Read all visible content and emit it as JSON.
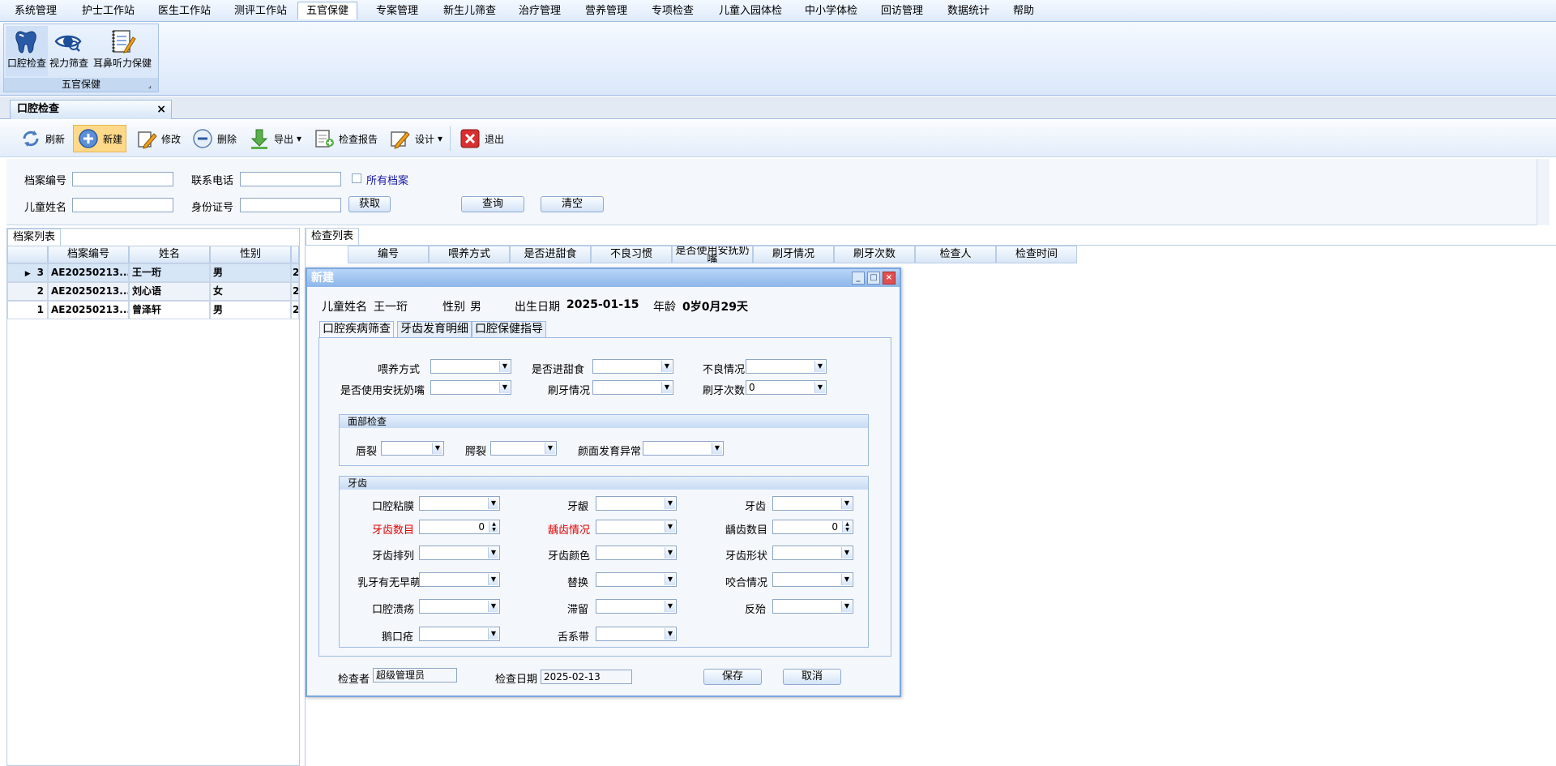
{
  "menu": {
    "items": [
      "系统管理",
      "护士工作站",
      "医生工作站",
      "测评工作站",
      "五官保健",
      "专案管理",
      "新生儿筛查",
      "治疗管理",
      "营养管理",
      "专项检查",
      "儿童入园体检",
      "中小学体检",
      "回访管理",
      "数据统计",
      "帮助"
    ],
    "active_index": 4
  },
  "ribbon": {
    "buttons": [
      {
        "label": "口腔检查",
        "icon": "tooth-icon"
      },
      {
        "label": "视力筛查",
        "icon": "eye-icon"
      },
      {
        "label": "耳鼻听力保健",
        "icon": "notepad-icon"
      }
    ],
    "group_title": "五官保健"
  },
  "doc_tab": {
    "label": "口腔检查",
    "close": "×"
  },
  "toolbar": {
    "refresh": "刷新",
    "new": "新建",
    "edit": "修改",
    "delete": "删除",
    "export": "导出",
    "report": "检查报告",
    "design": "设计",
    "exit": "退出",
    "dropdown": "▾"
  },
  "search": {
    "archive_no_label": "档案编号",
    "phone_label": "联系电话",
    "all_archives_label": "所有档案",
    "child_name_label": "儿童姓名",
    "id_card_label": "身份证号",
    "fetch_btn": "获取",
    "query_btn": "查询",
    "clear_btn": "清空"
  },
  "archive_list": {
    "tab": "档案列表",
    "headers": [
      "档案编号",
      "姓名",
      "性别"
    ],
    "rows": [
      {
        "num": "3",
        "archive": "AE20250213...",
        "name": "王一珩",
        "gender": "男",
        "extra": "2"
      },
      {
        "num": "2",
        "archive": "AE20250213...",
        "name": "刘心语",
        "gender": "女",
        "extra": "2"
      },
      {
        "num": "1",
        "archive": "AE20250213...",
        "name": "曾泽轩",
        "gender": "男",
        "extra": "2"
      }
    ],
    "row_pointer": "▶"
  },
  "check_list": {
    "tab": "检查列表",
    "headers": [
      "编号",
      "喂养方式",
      "是否进甜食",
      "不良习惯",
      "是否使用安抚奶嘴",
      "刷牙情况",
      "刷牙次数",
      "检查人",
      "检查时间"
    ]
  },
  "dialog": {
    "title": "新建",
    "controls": {
      "min": "_",
      "max": "□",
      "close": "×"
    },
    "child_name_label": "儿童姓名",
    "child_name": "王一珩",
    "gender_label": "性别",
    "gender": "男",
    "birth_label": "出生日期",
    "birth": "2025-01-15",
    "age_label": "年龄",
    "age": "0岁0月29天",
    "tabs": [
      "口腔疾病筛查",
      "牙齿发育明细",
      "口腔保健指导"
    ],
    "fields": {
      "feeding": "喂养方式",
      "sweets": "是否进甜食",
      "bad_habit": "不良情况",
      "pacifier": "是否使用安抚奶嘴",
      "brushing": "刷牙情况",
      "brush_times": "刷牙次数",
      "brush_times_value": "0"
    },
    "face_section": {
      "title": "面部检查",
      "lip": "唇裂",
      "palate": "腭裂",
      "face": "颜面发育异常"
    },
    "teeth_section": {
      "title": "牙齿",
      "mucosa": "口腔粘膜",
      "gum": "牙龈",
      "teeth": "牙齿",
      "teeth_count": "牙齿数目",
      "teeth_count_value": "0",
      "caries": "龋齿情况",
      "caries_count": "龋齿数目",
      "caries_count_value": "0",
      "alignment": "牙齿排列",
      "color": "牙齿颜色",
      "shape": "牙齿形状",
      "early_eruption": "乳牙有无早萌",
      "replace": "替换",
      "bite": "咬合情况",
      "ulcer": "口腔溃疡",
      "retention": "滞留",
      "crossbite": "反殆",
      "thrush": "鹅口疮",
      "tongue_tie": "舌系带"
    },
    "examiner_label": "检查者",
    "examiner": "超级管理员",
    "date_label": "检查日期",
    "date": "2025-02-13",
    "save_btn": "保存",
    "cancel_btn": "取消"
  }
}
